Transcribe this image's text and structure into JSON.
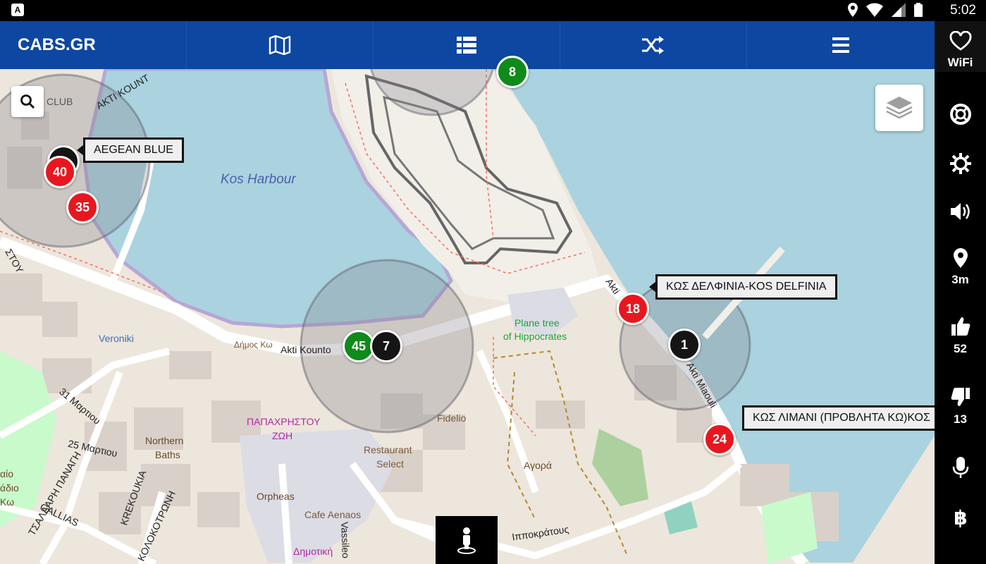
{
  "status_bar": {
    "notification_letter": "A",
    "time": "5:02"
  },
  "app_bar": {
    "brand": "CABS.GR",
    "tabs": [
      {
        "icon": "map-icon"
      },
      {
        "icon": "list-icon"
      },
      {
        "icon": "shuffle-icon"
      },
      {
        "icon": "menu-icon"
      }
    ]
  },
  "rail": {
    "wifi_label": "WiFi",
    "distance_label": "3m",
    "likes_count": "52",
    "dislikes_count": "13"
  },
  "markers": [
    {
      "label": "40",
      "color": "#e8171f"
    },
    {
      "label": "35",
      "color": "#e8171f"
    },
    {
      "label": "8",
      "color": "#0f8a1b"
    },
    {
      "label": "45",
      "color": "#0f8a1b"
    },
    {
      "label": "7",
      "color": "#151515"
    },
    {
      "label": "18",
      "color": "#e8171f"
    },
    {
      "label": "1",
      "color": "#151515"
    },
    {
      "label": "24",
      "color": "#e8171f"
    }
  ],
  "callouts": [
    "AEGEAN BLUE",
    "ΚΩΣ ΔΕΛΦΙΝΙΑ-KOS DELFINIA",
    "ΚΩΣ ΛΙΜΑΝΙ (ΠΡΟΒΛΗΤΑ ΚΩ)ΚΟΣ"
  ],
  "map_labels": {
    "harbour": "Kos Harbour",
    "plane_tree_1": "Plane tree",
    "plane_tree_2": "of Hippocrates",
    "akti_kountouriotou": "Akti Kounto",
    "dimos_ko": "Δήμος Κω",
    "akti_1": "Akti",
    "akti_miaouli": "Akti Miaouli",
    "veroniki": "Veroniki",
    "papachristou_1": "ΠΑΠΑΧΡΗΣΤΟΥ",
    "papachristou_2": "ΖΩΗ",
    "northern_1": "Northern",
    "northern_2": "Baths",
    "fidelio": "Fidelio",
    "restaurant_1": "Restaurant",
    "restaurant_2": "Select",
    "agora": "Αγορά",
    "orpheas": "Orpheas",
    "cafe_aenaos": "Cafe Aenaos",
    "vassileos": "Vassileo",
    "dimotiki": "Δημοτική",
    "ippokratous": "Ιπποκράτους",
    "marchiou_31": "31 Μαρτιου",
    "marchiou_25": "25 Μαρτιου",
    "tsaldari": "ΤΣΑΛΔΑΡΗ ΠΑΝΑΓΗ",
    "krekoukia": "KREKOUKIA",
    "kolokotroni": "ΚΟΛΟΚΟΤΡΩΝΗ",
    "gallias": "GALLIAS",
    "club": "CLUB",
    "akti_kount_top": "AKTI KOUNT",
    "stou": "ΣΤΟΥ",
    "archaio_1": "αίο",
    "archaio_2": "άδιο",
    "archaio_3": "Κω"
  }
}
